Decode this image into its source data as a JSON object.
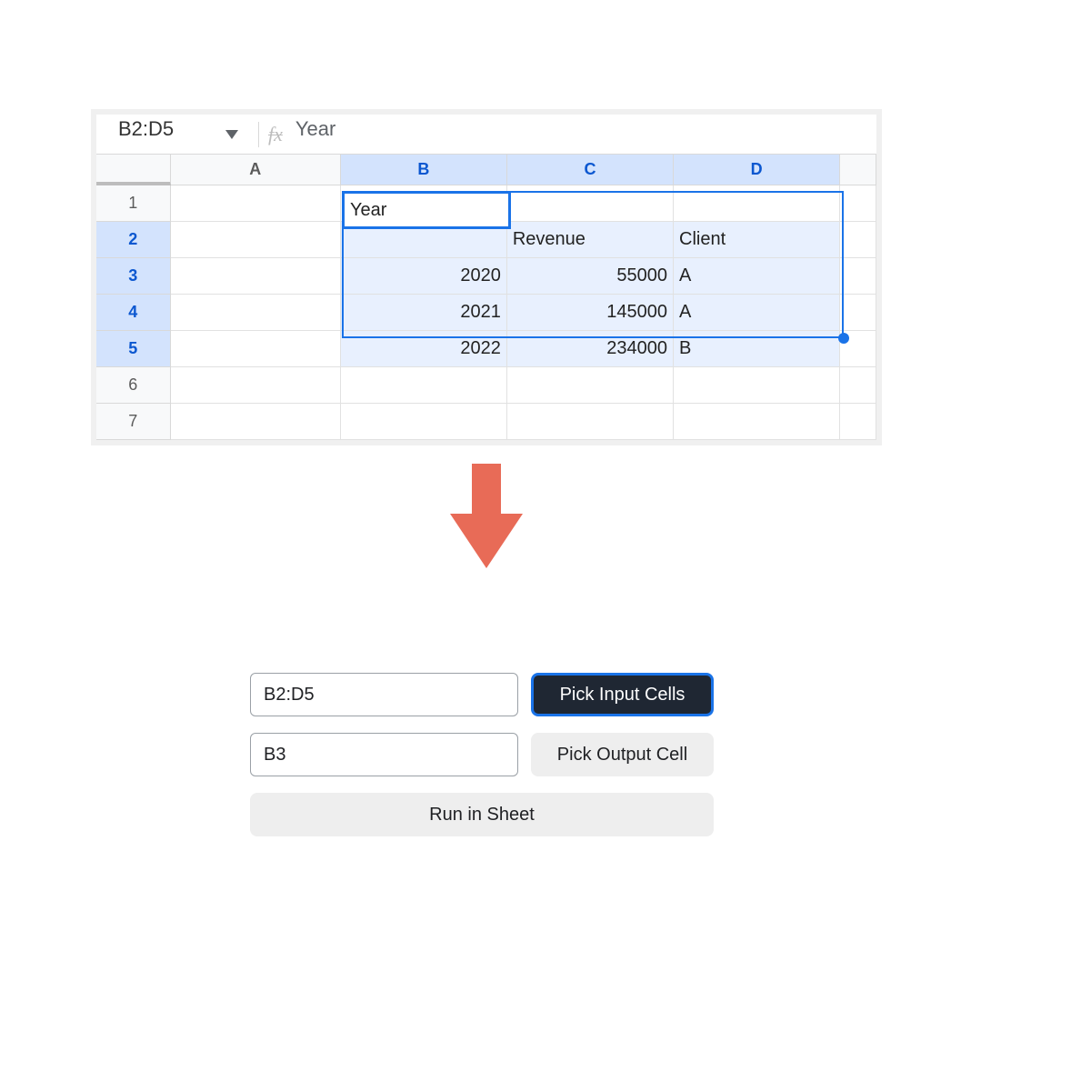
{
  "formula_bar": {
    "name_box": "B2:D5",
    "fx_label": "fx",
    "value": "Year"
  },
  "columns": [
    "A",
    "B",
    "C",
    "D"
  ],
  "selected_columns": [
    "B",
    "C",
    "D"
  ],
  "rows": [
    "1",
    "2",
    "3",
    "4",
    "5",
    "6",
    "7"
  ],
  "selected_rows": [
    "2",
    "3",
    "4",
    "5"
  ],
  "active_cell_value": "Year",
  "table": {
    "headers": {
      "B": "Year",
      "C": "Revenue",
      "D": "Client"
    },
    "rows": [
      {
        "B": "2020",
        "C": "55000",
        "D": "A"
      },
      {
        "B": "2021",
        "C": "145000",
        "D": "A"
      },
      {
        "B": "2022",
        "C": "234000",
        "D": "B"
      }
    ]
  },
  "arrow_color": "#e86b57",
  "controls": {
    "input_cells_value": "B2:D5",
    "output_cell_value": "B3",
    "pick_input_label": "Pick Input Cells",
    "pick_output_label": "Pick Output Cell",
    "run_label": "Run in Sheet"
  }
}
